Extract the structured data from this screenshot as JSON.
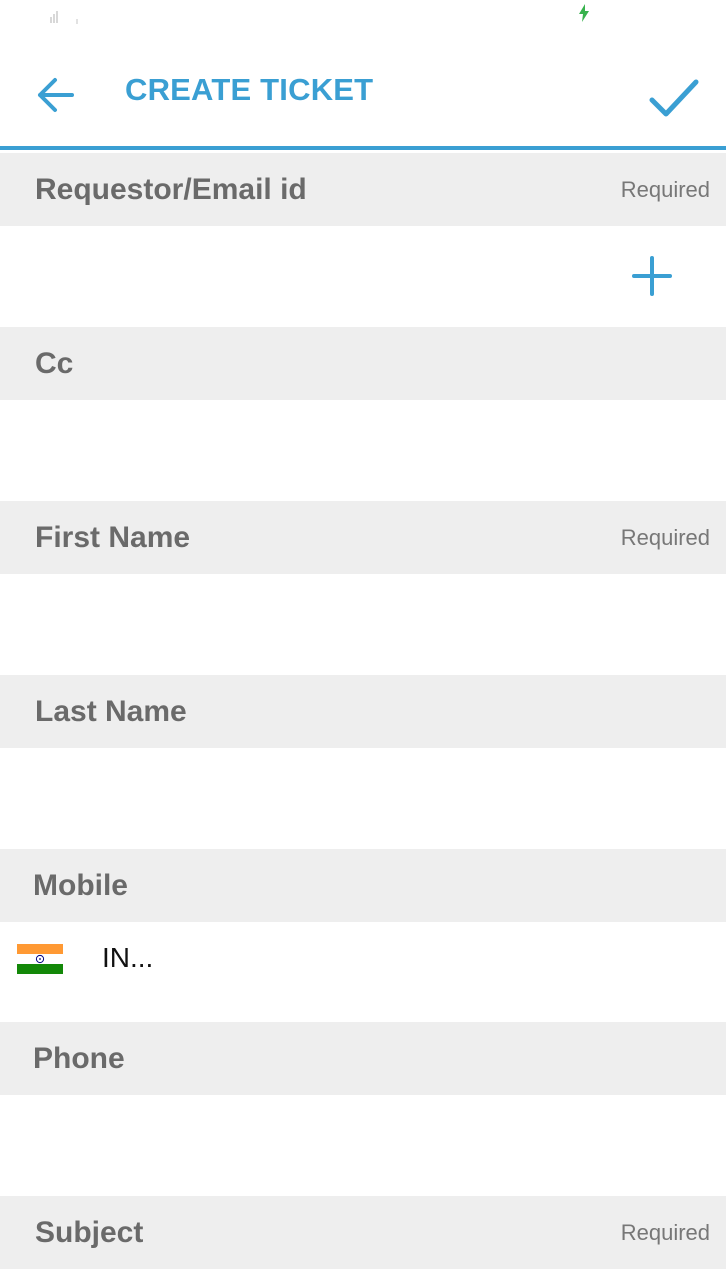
{
  "status_bar": {
    "icons": [
      "signal-icon",
      "charging-icon"
    ]
  },
  "app_bar": {
    "title": "CREATE TICKET",
    "back_icon": "arrow-left-icon",
    "confirm_icon": "check-icon",
    "accent_color": "#3a9fd3"
  },
  "form": {
    "required_label": "Required",
    "requestor": {
      "label": "Requestor/Email id",
      "required": "Required",
      "value": "",
      "add_icon": "plus-icon"
    },
    "cc": {
      "label": "Cc",
      "value": ""
    },
    "first_name": {
      "label": "First Name",
      "required": "Required",
      "value": ""
    },
    "last_name": {
      "label": "Last Name",
      "value": ""
    },
    "mobile": {
      "label": "Mobile",
      "country_code": "IN...",
      "flag_icon": "india-flag-icon"
    },
    "phone": {
      "label": "Phone",
      "value": ""
    },
    "subject": {
      "label": "Subject",
      "required": "Required"
    }
  }
}
